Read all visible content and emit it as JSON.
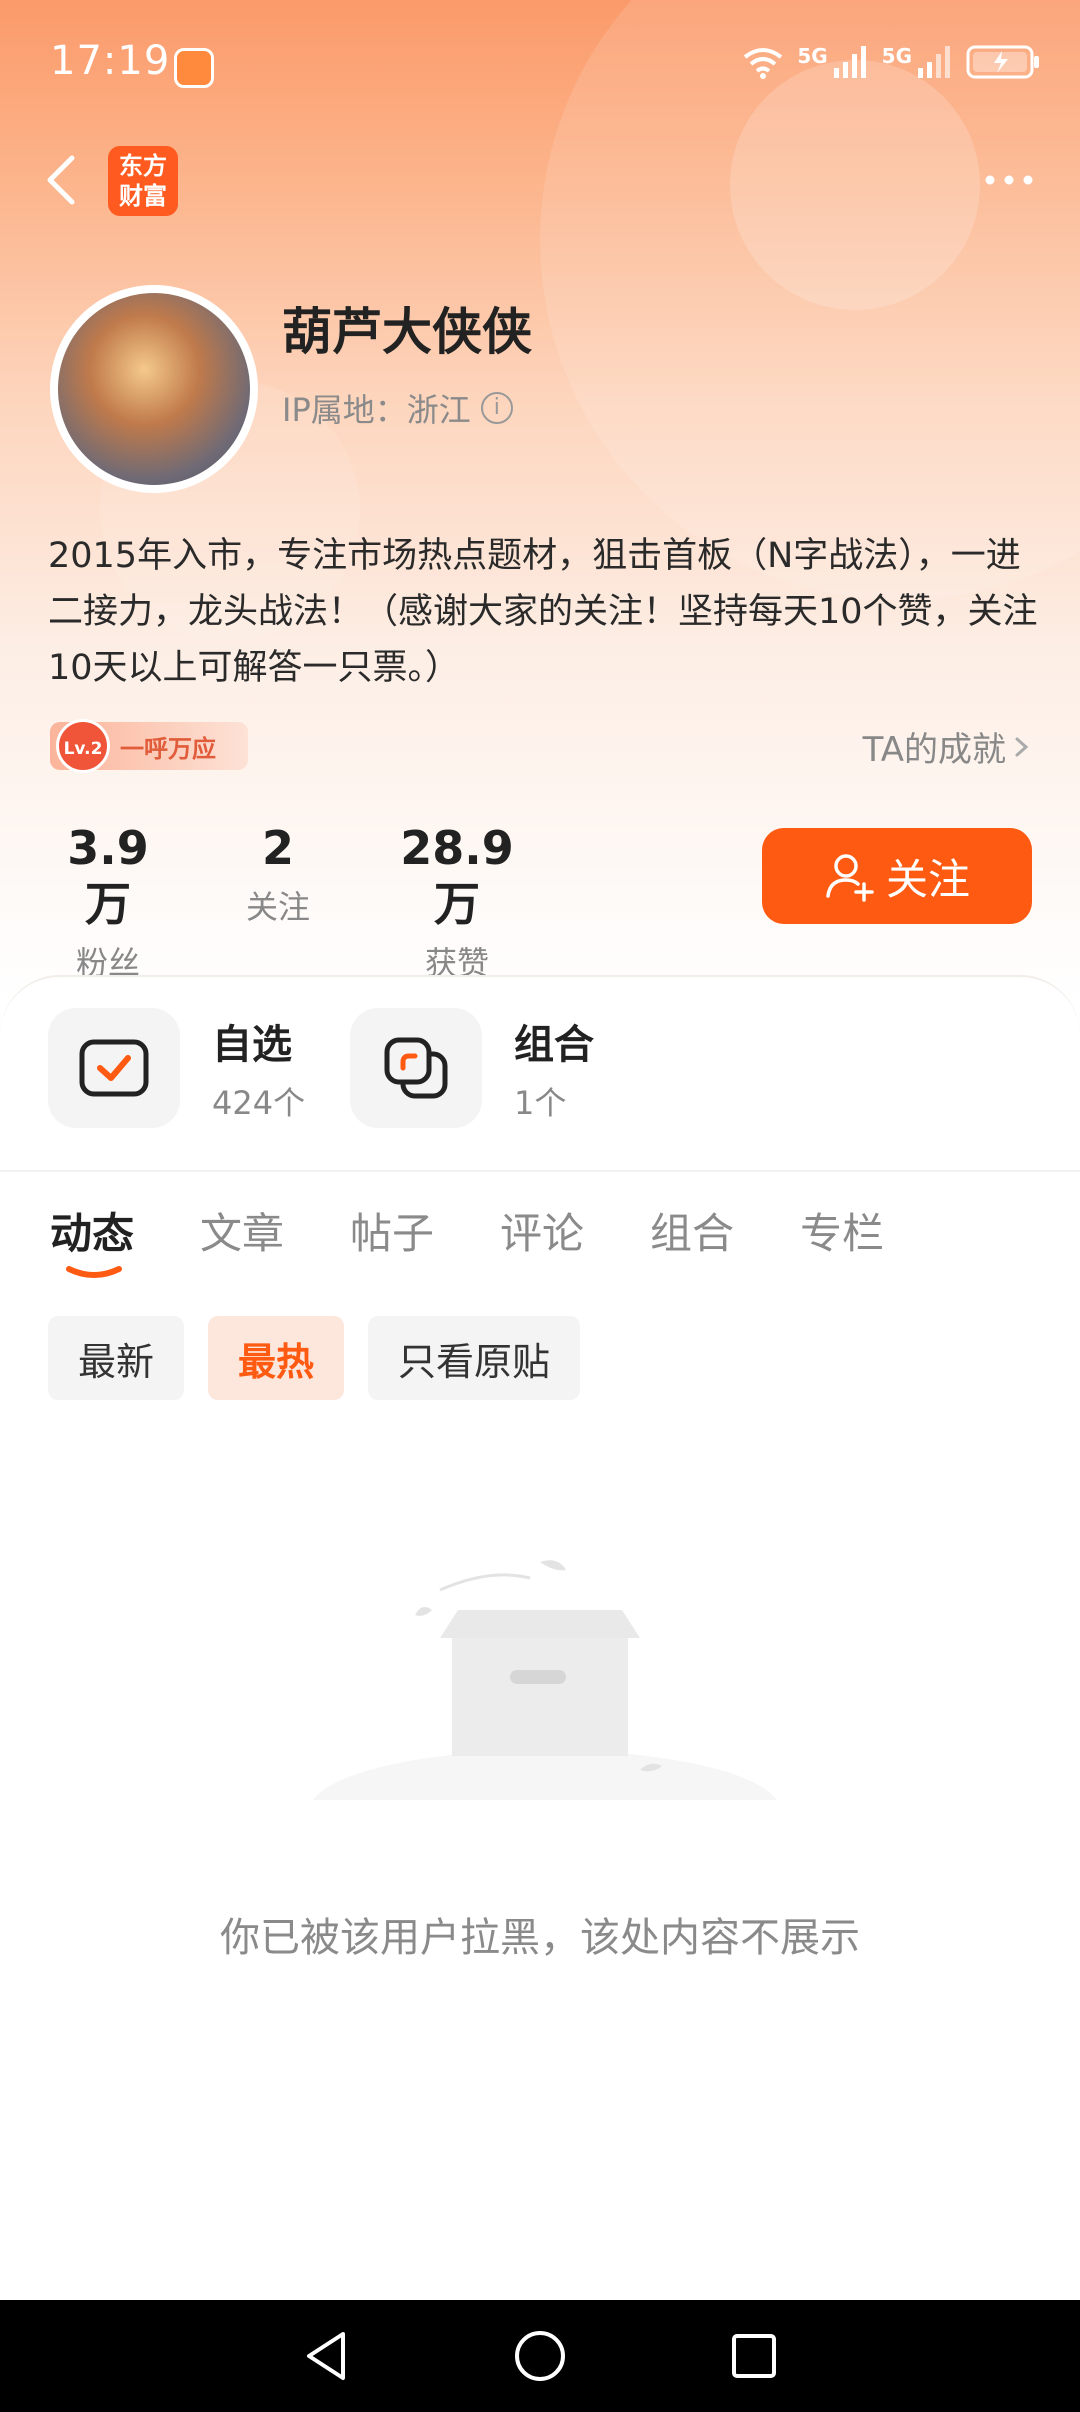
{
  "status_bar": {
    "time": "17:19",
    "network_1": "5G",
    "network_2": "5G"
  },
  "header": {
    "logo_line1": "东方",
    "logo_line2": "财富"
  },
  "profile": {
    "username": "葫芦大侠侠",
    "ip_location": "IP属地：浙江",
    "bio": "2015年入市，专注市场热点题材，狙击首板（N字战法），一进二接力，龙头战法！（感谢大家的关注！坚持每天10个赞，关注10天以上可解答一只票。）",
    "badge_level": "Lv.2",
    "badge_title": "一呼万应",
    "achievement_link": "TA的成就",
    "stats": [
      {
        "value": "3.9万",
        "label": "粉丝"
      },
      {
        "value": "2",
        "label": "关注"
      },
      {
        "value": "28.9万",
        "label": "获赞"
      }
    ],
    "follow_label": "关注"
  },
  "quick": [
    {
      "title": "自选",
      "count": "424个"
    },
    {
      "title": "组合",
      "count": "1个"
    }
  ],
  "tabs": [
    "动态",
    "文章",
    "帖子",
    "评论",
    "组合",
    "专栏"
  ],
  "active_tab": "动态",
  "filters": [
    "最新",
    "最热",
    "只看原贴"
  ],
  "active_filter": "最热",
  "empty_message": "你已被该用户拉黑，该处内容不展示",
  "colors": {
    "accent": "#ff5a12",
    "accent_light": "#fde6dc",
    "muted_text": "#8a8a8a"
  }
}
